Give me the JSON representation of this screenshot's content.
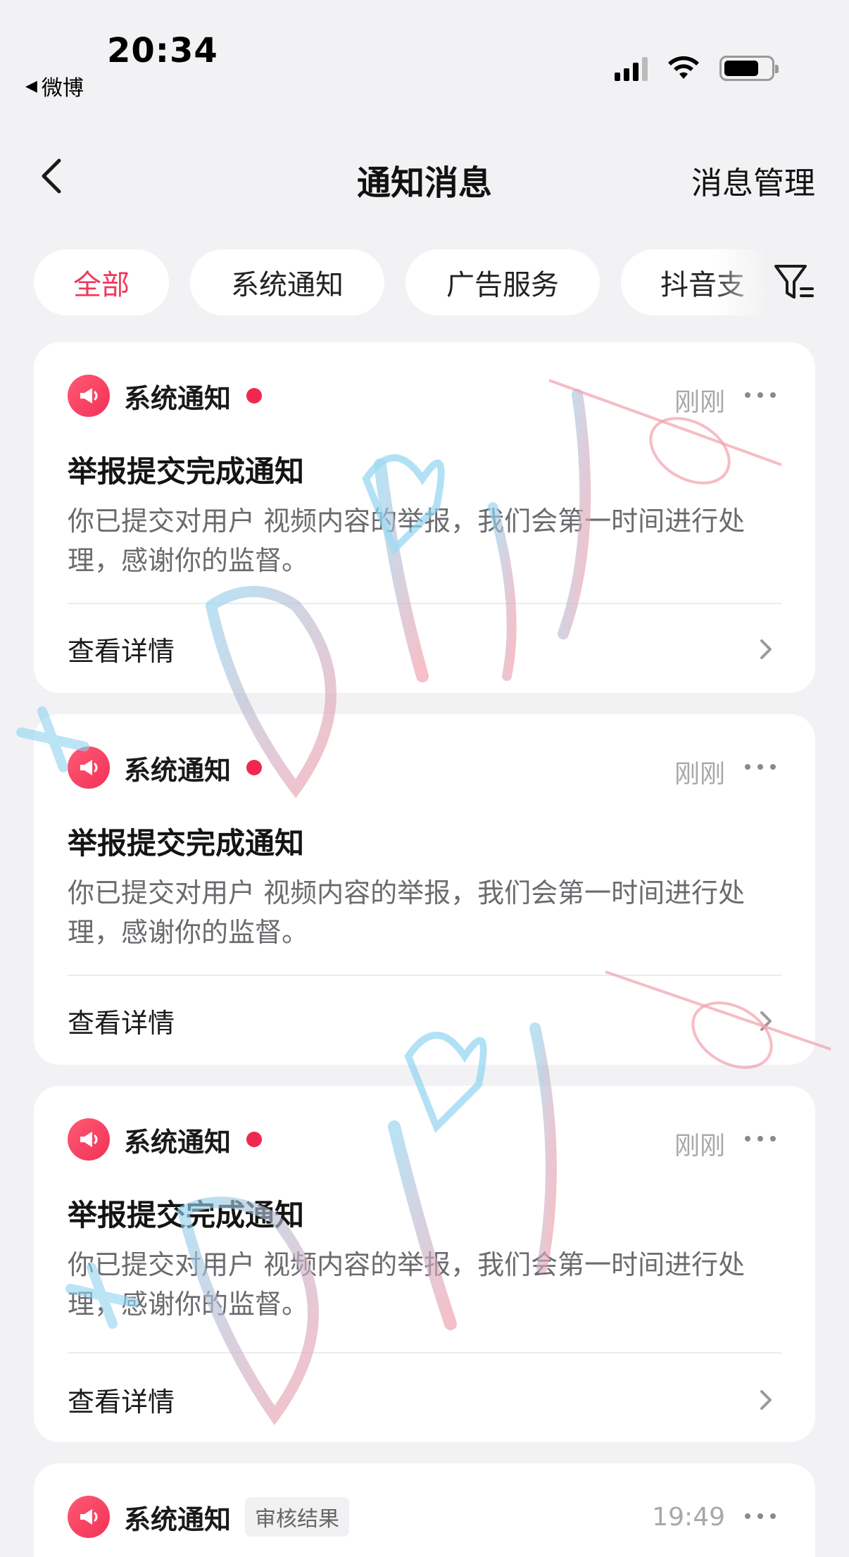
{
  "status_bar": {
    "time": "20:34",
    "back_app": "微博",
    "back_icon": "back-triangle-icon"
  },
  "nav": {
    "title": "通知消息",
    "manage": "消息管理",
    "back_icon": "chevron-left-icon"
  },
  "tabs": [
    {
      "label": "全部",
      "active": true
    },
    {
      "label": "系统通知",
      "active": false
    },
    {
      "label": "广告服务",
      "active": false
    },
    {
      "label": "抖音支",
      "active": false
    }
  ],
  "filter_icon": "filter-icon",
  "cards": [
    {
      "source": "系统通知",
      "unread": true,
      "time": "刚刚",
      "title": "举报提交完成通知",
      "body": "你已提交对用户                      视频内容的举报，我们会第一时间进行处理，感谢你的监督。",
      "detail": "查看详情"
    },
    {
      "source": "系统通知",
      "unread": true,
      "time": "刚刚",
      "title": "举报提交完成通知",
      "body": "你已提交对用户                      视频内容的举报，我们会第一时间进行处理，感谢你的监督。",
      "detail": "查看详情"
    },
    {
      "source": "系统通知",
      "unread": true,
      "time": "刚刚",
      "title": "举报提交完成通知",
      "body": "你已提交对用户                        视频内容的举报，我们会第一时间进行处理，感谢你的监督。",
      "detail": "查看详情"
    },
    {
      "source": "系统通知",
      "tag": "审核结果",
      "time": "19:49"
    }
  ],
  "watermark_text": "Dchil",
  "colors": {
    "accent": "#f0385a",
    "background": "#f2f2f4",
    "unread_dot": "#f0284f"
  }
}
